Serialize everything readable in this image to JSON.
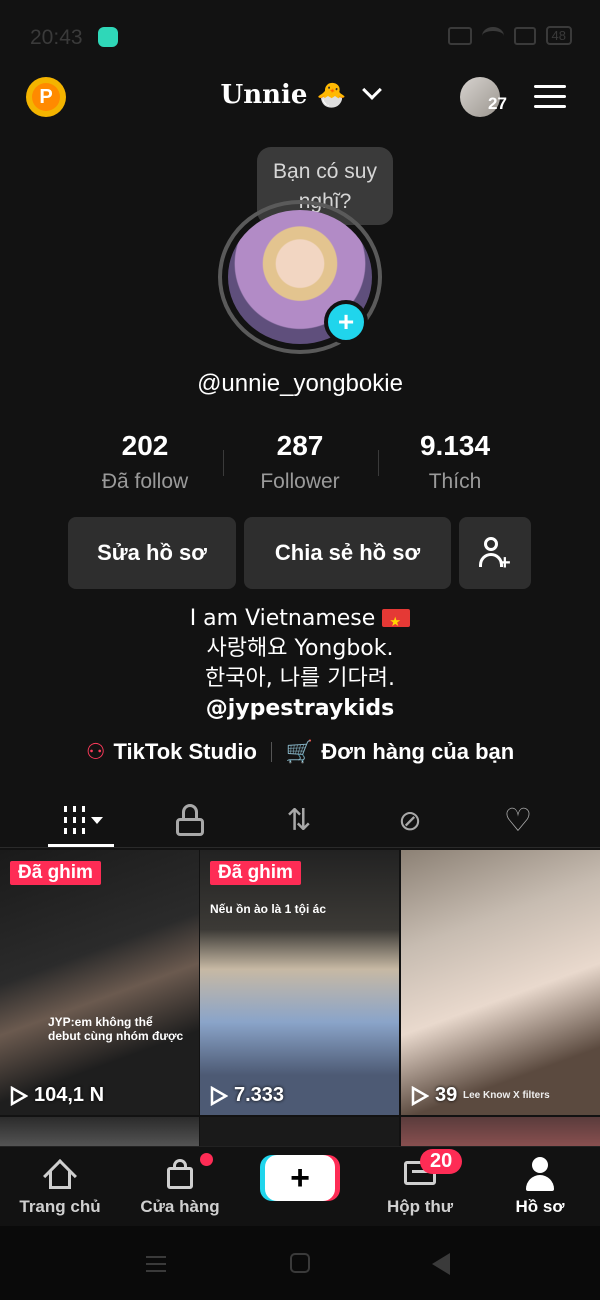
{
  "status_bar": {
    "time": "20:43",
    "battery": "48"
  },
  "header": {
    "username": "Unnie",
    "username_emoji": "🐣",
    "notification_count": "27"
  },
  "bubble": {
    "text": "Bạn có suy nghĩ?"
  },
  "profile": {
    "handle": "@unnie_yongbokie"
  },
  "stats": [
    {
      "value": "202",
      "label": "Đã follow"
    },
    {
      "value": "287",
      "label": "Follower"
    },
    {
      "value": "9.134",
      "label": "Thích"
    }
  ],
  "buttons": {
    "edit": "Sửa hồ sơ",
    "share": "Chia sẻ hồ sơ"
  },
  "bio": {
    "line1": "I am Vietnamese",
    "line2": "사랑해요 Yongbok.",
    "line3": "한국아, 나를 기다려.",
    "link": "@jypestraykids"
  },
  "links": {
    "studio": "TikTok Studio",
    "orders": "Đơn hàng của bạn"
  },
  "videos": [
    {
      "pinned": "Đã ghim",
      "views": "104,1 N",
      "caption": "JYP:em không thể debut cùng nhóm được"
    },
    {
      "pinned": "Đã ghim",
      "views": "7.333",
      "caption": "Nếu ồn ào là 1 tội ác"
    },
    {
      "pinned": "",
      "views": "39",
      "caption": "Lee Know X filters"
    }
  ],
  "nav": {
    "home": "Trang chủ",
    "shop": "Cửa hàng",
    "inbox": "Hộp thư",
    "inbox_count": "20",
    "profile": "Hồ sơ"
  },
  "colors": {
    "accent_red": "#fe2c55",
    "accent_cyan": "#20d5ec",
    "background": "#121212"
  }
}
